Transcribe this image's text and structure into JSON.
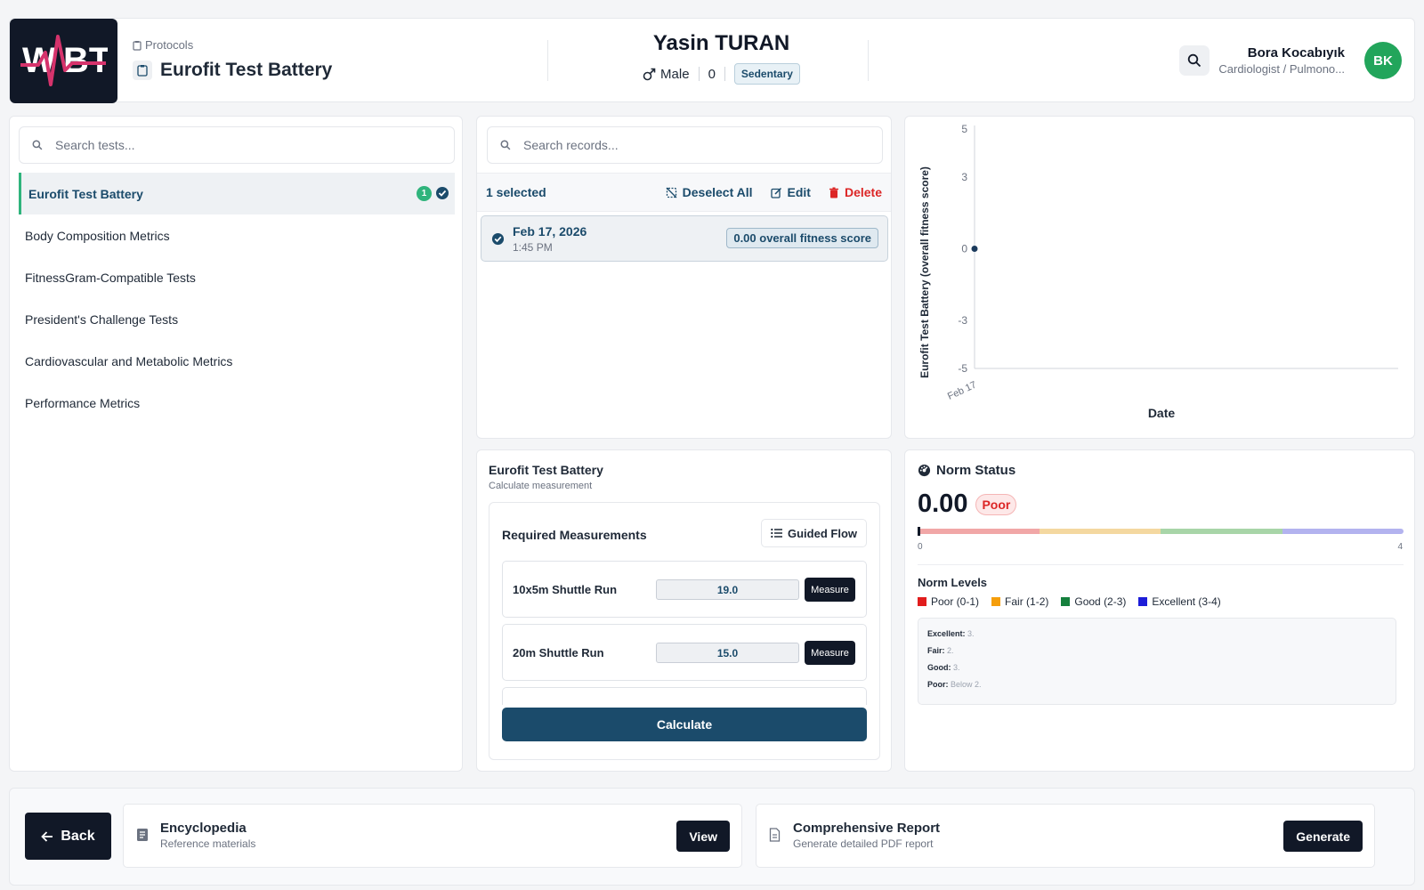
{
  "header": {
    "breadcrumb": "Protocols",
    "page_title": "Eurofit Test Battery",
    "patient": {
      "name": "Yasin TURAN",
      "gender": "Male",
      "age": "0",
      "activity": "Sedentary"
    },
    "user": {
      "name": "Bora Kocabıyık",
      "role": "Cardiologist / Pulmono...",
      "initials": "BK"
    },
    "icons": [
      "clipboard-icon",
      "male-icon",
      "search-icon"
    ]
  },
  "tests": {
    "search_placeholder": "Search tests...",
    "items": [
      {
        "label": "Eurofit Test Battery",
        "count": "1",
        "active": true
      },
      {
        "label": "Body Composition Metrics"
      },
      {
        "label": "FitnessGram-Compatible Tests"
      },
      {
        "label": "President's Challenge Tests"
      },
      {
        "label": "Cardiovascular and Metabolic Metrics"
      },
      {
        "label": "Performance Metrics"
      }
    ]
  },
  "records": {
    "search_placeholder": "Search records...",
    "selected_text": "1 selected",
    "deselect_label": "Deselect All",
    "edit_label": "Edit",
    "delete_label": "Delete",
    "items": [
      {
        "date": "Feb 17, 2026",
        "time": "1:45 PM",
        "score": "0.00 overall fitness score"
      }
    ]
  },
  "chart_data": {
    "type": "scatter",
    "x": [
      "Feb 17"
    ],
    "y": [
      0
    ],
    "xlabel": "Date",
    "ylabel": "Eurofit Test Battery (overall fitness score)",
    "ylim": [
      -5,
      5
    ],
    "yticks": [
      "5",
      "3",
      "0",
      "-3",
      "-5"
    ],
    "point_color": "#1b3a5c"
  },
  "calculator": {
    "title": "Eurofit Test Battery",
    "subtitle": "Calculate measurement",
    "required_label": "Required Measurements",
    "guided_label": "Guided Flow",
    "measurements": [
      {
        "label": "10x5m Shuttle Run",
        "value": "19.0",
        "button": "Measure"
      },
      {
        "label": "20m Shuttle Run",
        "value": "15.0",
        "button": "Measure"
      }
    ],
    "calculate_label": "Calculate"
  },
  "norm": {
    "title": "Norm Status",
    "value": "0.00",
    "status": "Poor",
    "min": "0",
    "max": "4",
    "levels_title": "Norm Levels",
    "legend": [
      {
        "label": "Poor (0-1)",
        "color": "#e11d1d"
      },
      {
        "label": "Fair (1-2)",
        "color": "#f59e0b"
      },
      {
        "label": "Good (2-3)",
        "color": "#15803d"
      },
      {
        "label": "Excellent (3-4)",
        "color": "#1d1dd8"
      }
    ],
    "bar_colors": [
      "#f1a7a7",
      "#f4d8a0",
      "#a8d5a8",
      "#b3b3ef"
    ],
    "descriptions": [
      {
        "k": "Excellent:",
        "v": "3."
      },
      {
        "k": "Fair:",
        "v": "2."
      },
      {
        "k": "Good:",
        "v": "3."
      },
      {
        "k": "Poor:",
        "v": "Below 2."
      }
    ]
  },
  "footer": {
    "back_label": "Back",
    "encyclopedia": {
      "title": "Encyclopedia",
      "subtitle": "Reference materials",
      "button": "View"
    },
    "report": {
      "title": "Comprehensive Report",
      "subtitle": "Generate detailed PDF report",
      "button": "Generate"
    }
  }
}
